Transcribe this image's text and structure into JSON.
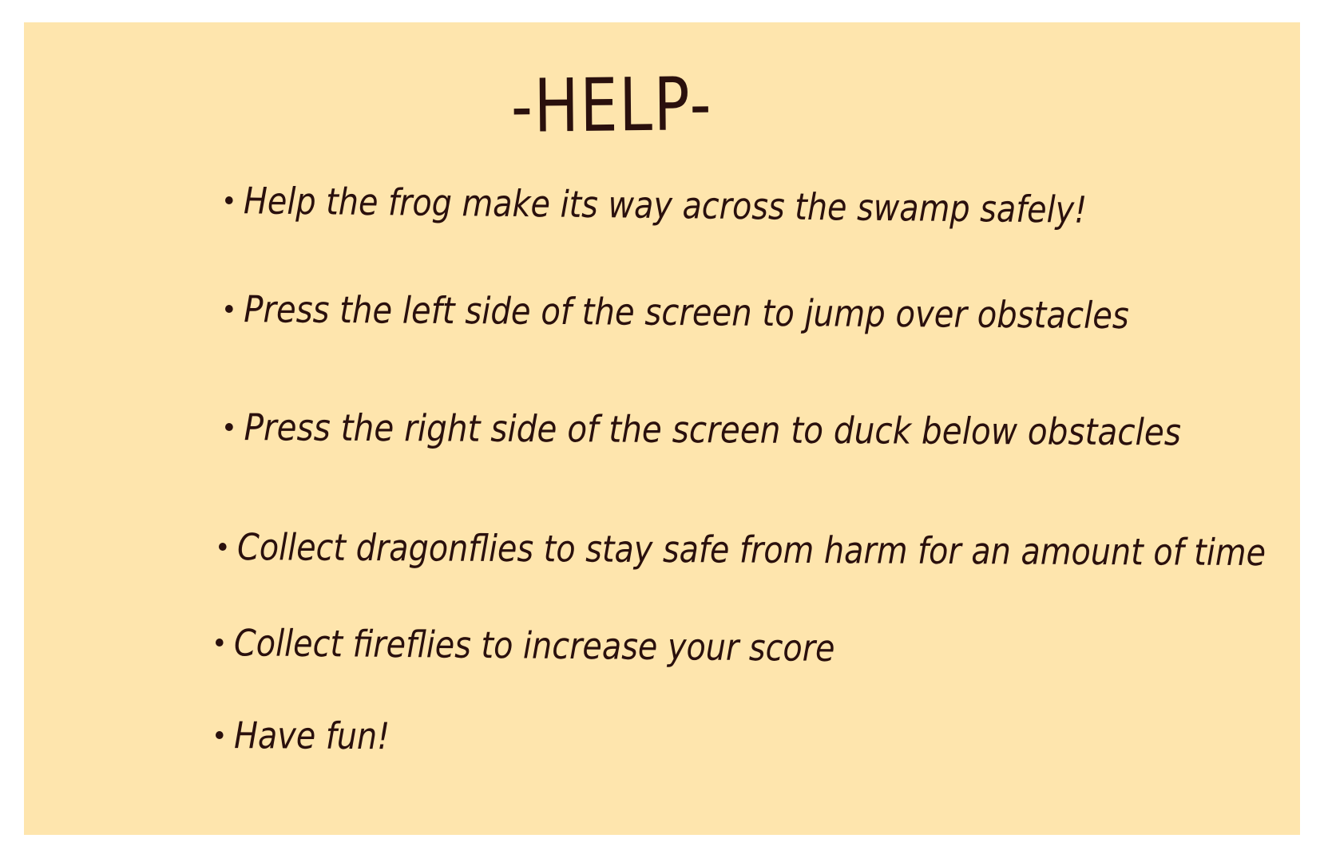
{
  "screen": {
    "background_color": "#fee5ad",
    "text_color": "#2a100d"
  },
  "help": {
    "title": "-HELP-",
    "items": [
      "Help the frog make its way across the swamp safely!",
      "Press the left side of the screen to jump over obstacles",
      "Press the right side of the screen to duck below obstacles",
      "Collect dragonflies to stay safe from harm for an amount of time",
      "Collect fireflies to increase your score",
      "Have fun!"
    ]
  }
}
